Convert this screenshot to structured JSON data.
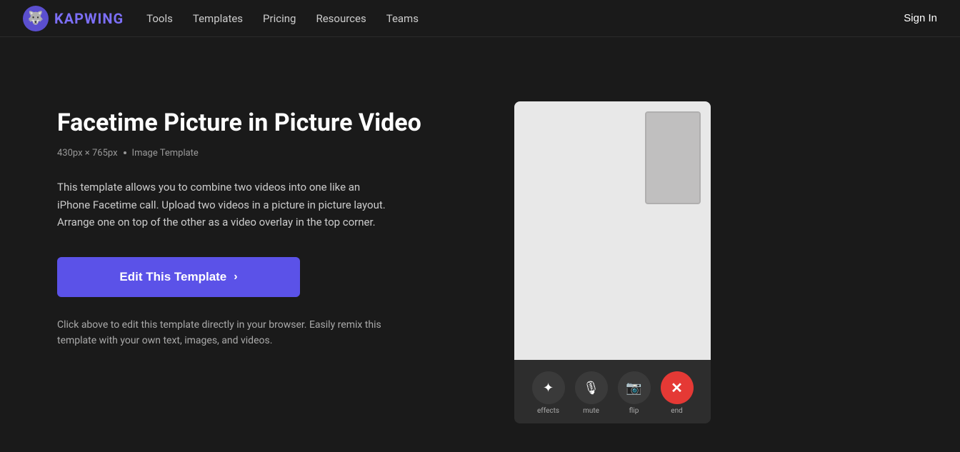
{
  "nav": {
    "logo_text": "KAPWING",
    "logo_icon": "🐺",
    "links": [
      {
        "label": "Tools",
        "id": "tools"
      },
      {
        "label": "Templates",
        "id": "templates"
      },
      {
        "label": "Pricing",
        "id": "pricing"
      },
      {
        "label": "Resources",
        "id": "resources"
      },
      {
        "label": "Teams",
        "id": "teams"
      }
    ],
    "signin_label": "Sign In"
  },
  "page": {
    "title": "Facetime Picture in Picture Video",
    "dimensions": "430px × 765px",
    "template_type": "Image Template",
    "description": "This template allows you to combine two videos into one like an iPhone Facetime call. Upload two videos in a picture in picture layout. Arrange one on top of the other as a video overlay in the top corner.",
    "edit_button_label": "Edit This Template",
    "bottom_note": "Click above to edit this template directly in your browser. Easily remix this template with your own text, images, and videos."
  },
  "preview": {
    "controls": [
      {
        "icon": "✦",
        "label": "effects"
      },
      {
        "icon": "🎙",
        "label": "mute"
      },
      {
        "icon": "📷",
        "label": "flip"
      },
      {
        "icon": "✕",
        "label": "end",
        "red": true
      }
    ]
  }
}
